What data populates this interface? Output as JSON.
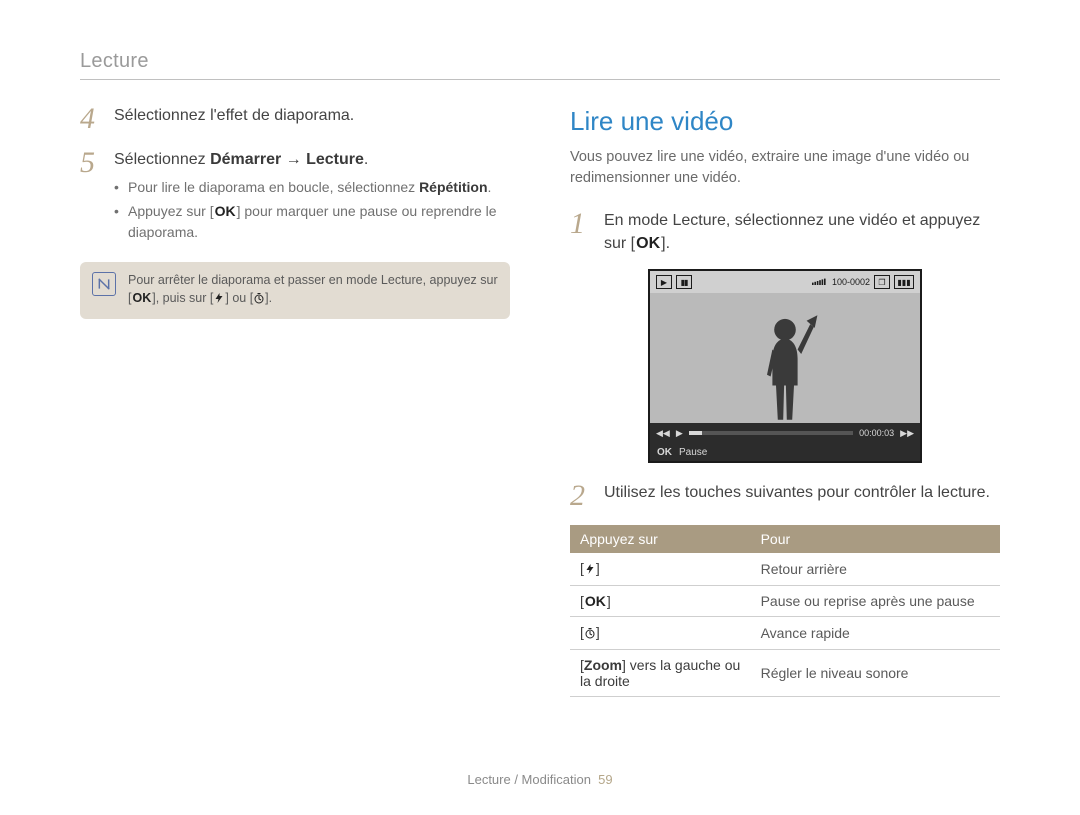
{
  "header": {
    "section_title": "Lecture"
  },
  "left": {
    "steps": [
      {
        "num": "4",
        "text": "Sélectionnez l'effet de diaporama."
      },
      {
        "num": "5",
        "text_prefix": "Sélectionnez ",
        "text_bold": "Démarrer → Lecture",
        "text_suffix": ".",
        "bullets": [
          {
            "pre": "Pour lire le diaporama en boucle, sélectionnez ",
            "bold": "Répétition",
            "post": "."
          },
          {
            "pre": "Appuyez sur [",
            "key_ok": true,
            "post": "] pour marquer une pause ou reprendre le diaporama."
          }
        ]
      }
    ],
    "note": {
      "line_pre": "Pour arrêter le diaporama et passer en mode Lecture, appuyez sur [",
      "ok": true,
      "line_mid": "], puis sur [",
      "flash": true,
      "or_text": "] ou [",
      "timer": true,
      "end": "]."
    }
  },
  "right": {
    "title": "Lire une vidéo",
    "desc": "Vous pouvez lire une vidéo, extraire une image d'une vidéo ou redimensionner une vidéo.",
    "steps": [
      {
        "num": "1",
        "text_pre": "En mode Lecture, sélectionnez une vidéo et appuyez sur [",
        "key_ok": true,
        "text_post": "]."
      },
      {
        "num": "2",
        "text": "Utilisez les touches suivantes pour contrôler la lecture."
      }
    ],
    "preview": {
      "timecode": "00:00:03",
      "file_index": "100-0002",
      "ok_label": "OK",
      "pause_label": "Pause",
      "rew": "◀◀",
      "play": "▶",
      "ff": "▶▶"
    },
    "table": {
      "hdr_press": "Appuyez sur",
      "hdr_to": "Pour",
      "rows": [
        {
          "press_icon": "flash",
          "action": "Retour arrière"
        },
        {
          "press_icon": "ok",
          "action": "Pause ou reprise après une pause"
        },
        {
          "press_icon": "timer",
          "action": "Avance rapide"
        },
        {
          "press_bold": "Zoom",
          "press_rest": " vers la gauche ou la droite",
          "action": "Régler le niveau sonore"
        }
      ]
    }
  },
  "footer": {
    "breadcrumb": "Lecture / Modification",
    "page_number": "59"
  }
}
